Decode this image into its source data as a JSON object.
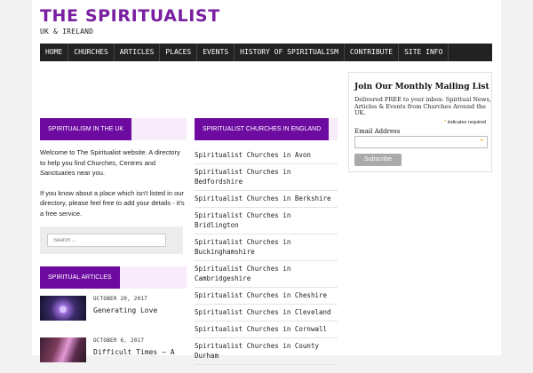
{
  "site": {
    "title": "THE SPIRITUALIST",
    "tagline": "UK & IRELAND"
  },
  "nav": {
    "items": [
      {
        "label": "HOME"
      },
      {
        "label": "CHURCHES"
      },
      {
        "label": "ARTICLES"
      },
      {
        "label": "PLACES"
      },
      {
        "label": "EVENTS"
      },
      {
        "label": "HISTORY OF SPIRITUALISM"
      },
      {
        "label": "CONTRIBUTE"
      },
      {
        "label": "SITE INFO"
      }
    ]
  },
  "left": {
    "heading": "SPIRITUALISM IN THE UK",
    "intro_p1": "Welcome to The Spiritualist website. A directory to help you find Churches, Centres and Sanctuaries near you.",
    "intro_p2": "If you know about a place which isn't listed in our directory, please feel free to add your details - it's a free service.",
    "search_placeholder": "Search ...",
    "articles_heading": "SPIRITUAL ARTICLES",
    "articles": [
      {
        "date": "OCTOBER 20, 2017",
        "title": "Generating Love"
      },
      {
        "date": "OCTOBER 6, 2017",
        "title": "Difficult Times – A"
      }
    ]
  },
  "middle": {
    "heading": "SPIRITUALIST CHURCHES IN ENGLAND",
    "churches": [
      "Spiritualist Churches in Avon",
      "Spiritualist Churches in Bedfordshire",
      "Spiritualist Churches in Berkshire",
      "Spiritualist Churches in Bridlington",
      "Spiritualist Churches in Buckinghamshire",
      "Spiritualist Churches in Cambridgeshire",
      "Spiritualist Churches in Cheshire",
      "Spiritualist Churches in Cleveland",
      "Spiritualist Churches in Cornwall",
      "Spiritualist Churches in County Durham"
    ]
  },
  "mailing": {
    "title": "Join Our Monthly Mailing List",
    "desc": "Delivered FREE to your inbox: Spiritual News, Articles & Events from Churches Around the UK.",
    "required_star": "*",
    "required_text": " indicates required",
    "email_label": "Email Address",
    "field_star": "*",
    "button": "Subscribe"
  },
  "colors": {
    "accent": "#6d0aa0",
    "title": "#7a1fa2",
    "nav_bg": "#222222"
  }
}
